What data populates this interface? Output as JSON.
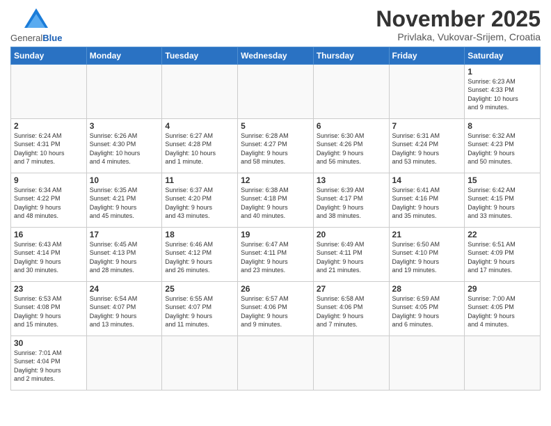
{
  "header": {
    "logo_general": "General",
    "logo_blue": "Blue",
    "month_title": "November 2025",
    "location": "Privlaka, Vukovar-Srijem, Croatia"
  },
  "days_of_week": [
    "Sunday",
    "Monday",
    "Tuesday",
    "Wednesday",
    "Thursday",
    "Friday",
    "Saturday"
  ],
  "weeks": [
    [
      {
        "day": "",
        "info": ""
      },
      {
        "day": "",
        "info": ""
      },
      {
        "day": "",
        "info": ""
      },
      {
        "day": "",
        "info": ""
      },
      {
        "day": "",
        "info": ""
      },
      {
        "day": "",
        "info": ""
      },
      {
        "day": "1",
        "info": "Sunrise: 6:23 AM\nSunset: 4:33 PM\nDaylight: 10 hours\nand 9 minutes."
      }
    ],
    [
      {
        "day": "2",
        "info": "Sunrise: 6:24 AM\nSunset: 4:31 PM\nDaylight: 10 hours\nand 7 minutes."
      },
      {
        "day": "3",
        "info": "Sunrise: 6:26 AM\nSunset: 4:30 PM\nDaylight: 10 hours\nand 4 minutes."
      },
      {
        "day": "4",
        "info": "Sunrise: 6:27 AM\nSunset: 4:28 PM\nDaylight: 10 hours\nand 1 minute."
      },
      {
        "day": "5",
        "info": "Sunrise: 6:28 AM\nSunset: 4:27 PM\nDaylight: 9 hours\nand 58 minutes."
      },
      {
        "day": "6",
        "info": "Sunrise: 6:30 AM\nSunset: 4:26 PM\nDaylight: 9 hours\nand 56 minutes."
      },
      {
        "day": "7",
        "info": "Sunrise: 6:31 AM\nSunset: 4:24 PM\nDaylight: 9 hours\nand 53 minutes."
      },
      {
        "day": "8",
        "info": "Sunrise: 6:32 AM\nSunset: 4:23 PM\nDaylight: 9 hours\nand 50 minutes."
      }
    ],
    [
      {
        "day": "9",
        "info": "Sunrise: 6:34 AM\nSunset: 4:22 PM\nDaylight: 9 hours\nand 48 minutes."
      },
      {
        "day": "10",
        "info": "Sunrise: 6:35 AM\nSunset: 4:21 PM\nDaylight: 9 hours\nand 45 minutes."
      },
      {
        "day": "11",
        "info": "Sunrise: 6:37 AM\nSunset: 4:20 PM\nDaylight: 9 hours\nand 43 minutes."
      },
      {
        "day": "12",
        "info": "Sunrise: 6:38 AM\nSunset: 4:18 PM\nDaylight: 9 hours\nand 40 minutes."
      },
      {
        "day": "13",
        "info": "Sunrise: 6:39 AM\nSunset: 4:17 PM\nDaylight: 9 hours\nand 38 minutes."
      },
      {
        "day": "14",
        "info": "Sunrise: 6:41 AM\nSunset: 4:16 PM\nDaylight: 9 hours\nand 35 minutes."
      },
      {
        "day": "15",
        "info": "Sunrise: 6:42 AM\nSunset: 4:15 PM\nDaylight: 9 hours\nand 33 minutes."
      }
    ],
    [
      {
        "day": "16",
        "info": "Sunrise: 6:43 AM\nSunset: 4:14 PM\nDaylight: 9 hours\nand 30 minutes."
      },
      {
        "day": "17",
        "info": "Sunrise: 6:45 AM\nSunset: 4:13 PM\nDaylight: 9 hours\nand 28 minutes."
      },
      {
        "day": "18",
        "info": "Sunrise: 6:46 AM\nSunset: 4:12 PM\nDaylight: 9 hours\nand 26 minutes."
      },
      {
        "day": "19",
        "info": "Sunrise: 6:47 AM\nSunset: 4:11 PM\nDaylight: 9 hours\nand 23 minutes."
      },
      {
        "day": "20",
        "info": "Sunrise: 6:49 AM\nSunset: 4:11 PM\nDaylight: 9 hours\nand 21 minutes."
      },
      {
        "day": "21",
        "info": "Sunrise: 6:50 AM\nSunset: 4:10 PM\nDaylight: 9 hours\nand 19 minutes."
      },
      {
        "day": "22",
        "info": "Sunrise: 6:51 AM\nSunset: 4:09 PM\nDaylight: 9 hours\nand 17 minutes."
      }
    ],
    [
      {
        "day": "23",
        "info": "Sunrise: 6:53 AM\nSunset: 4:08 PM\nDaylight: 9 hours\nand 15 minutes."
      },
      {
        "day": "24",
        "info": "Sunrise: 6:54 AM\nSunset: 4:07 PM\nDaylight: 9 hours\nand 13 minutes."
      },
      {
        "day": "25",
        "info": "Sunrise: 6:55 AM\nSunset: 4:07 PM\nDaylight: 9 hours\nand 11 minutes."
      },
      {
        "day": "26",
        "info": "Sunrise: 6:57 AM\nSunset: 4:06 PM\nDaylight: 9 hours\nand 9 minutes."
      },
      {
        "day": "27",
        "info": "Sunrise: 6:58 AM\nSunset: 4:06 PM\nDaylight: 9 hours\nand 7 minutes."
      },
      {
        "day": "28",
        "info": "Sunrise: 6:59 AM\nSunset: 4:05 PM\nDaylight: 9 hours\nand 6 minutes."
      },
      {
        "day": "29",
        "info": "Sunrise: 7:00 AM\nSunset: 4:05 PM\nDaylight: 9 hours\nand 4 minutes."
      }
    ],
    [
      {
        "day": "30",
        "info": "Sunrise: 7:01 AM\nSunset: 4:04 PM\nDaylight: 9 hours\nand 2 minutes."
      },
      {
        "day": "",
        "info": ""
      },
      {
        "day": "",
        "info": ""
      },
      {
        "day": "",
        "info": ""
      },
      {
        "day": "",
        "info": ""
      },
      {
        "day": "",
        "info": ""
      },
      {
        "day": "",
        "info": ""
      }
    ]
  ]
}
